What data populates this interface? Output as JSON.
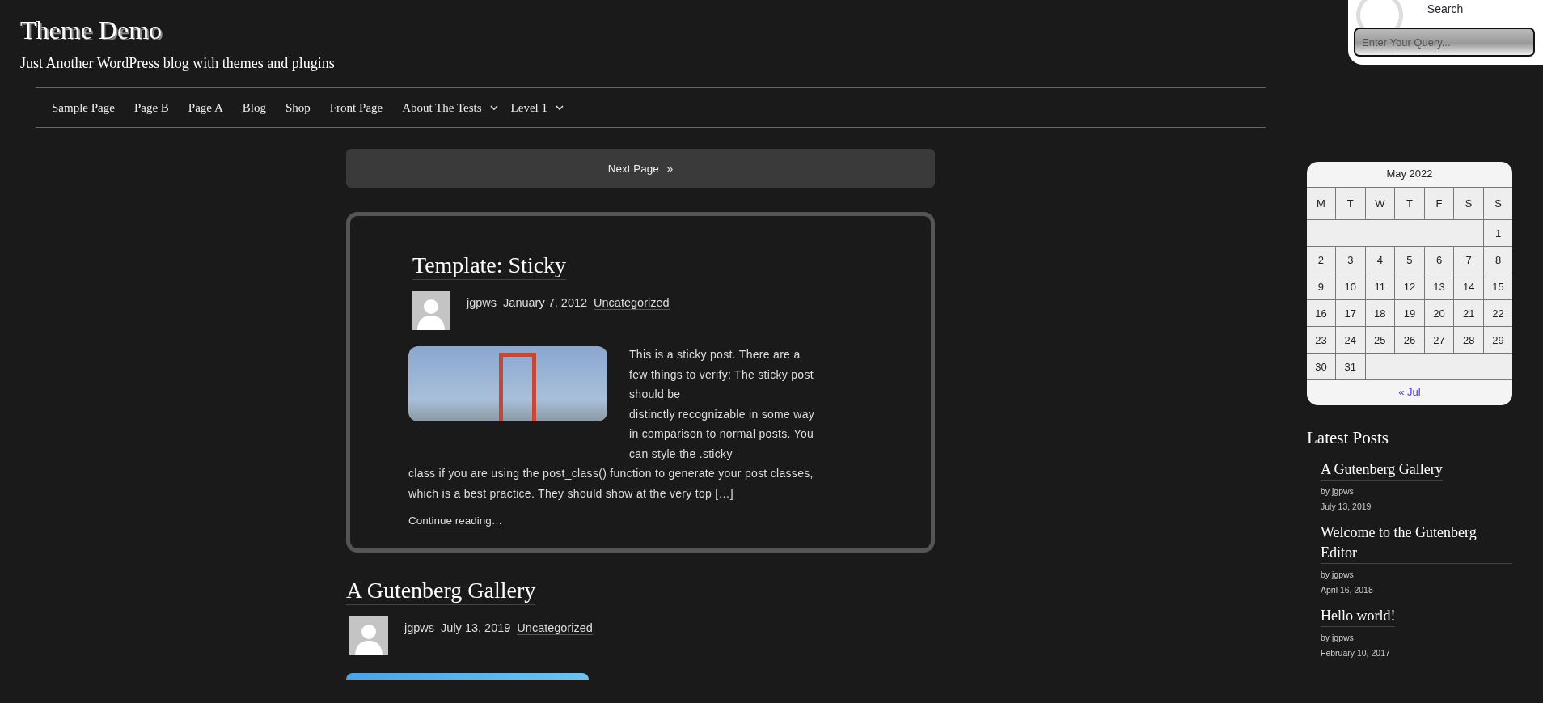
{
  "site": {
    "title": "Theme Demo",
    "tagline": "Just Another WordPress blog with themes and plugins"
  },
  "nav": {
    "items": [
      {
        "label": "Sample Page",
        "has_submenu": false
      },
      {
        "label": "Page B",
        "has_submenu": false
      },
      {
        "label": "Page A",
        "has_submenu": false
      },
      {
        "label": "Blog",
        "has_submenu": false
      },
      {
        "label": "Shop",
        "has_submenu": false
      },
      {
        "label": "Front Page",
        "has_submenu": false
      },
      {
        "label": "About The Tests",
        "has_submenu": true
      },
      {
        "label": "Level 1",
        "has_submenu": true
      }
    ]
  },
  "search": {
    "label": "Search",
    "placeholder": "Enter Your Query..."
  },
  "pagination": {
    "next": "Next Page",
    "next_glyph": "»"
  },
  "posts": [
    {
      "title": "Template: Sticky",
      "sticky": true,
      "author": "jgpws",
      "date": "January 7, 2012",
      "category": "Uncategorized",
      "excerpt_side_lines": [
        "This is a sticky post. There are a few things to verify: The sticky post should be",
        "distinctly recognizable in some way in comparison to normal posts. You can style the .sticky"
      ],
      "excerpt_below": "class if you are using the post_class() function to generate your post classes, which is a best practice. They should show at the very top […]",
      "more": "Continue reading…"
    },
    {
      "title": "A Gutenberg Gallery",
      "sticky": false,
      "author": "jgpws",
      "date": "July 13, 2019",
      "category": "Uncategorized"
    }
  ],
  "calendar": {
    "caption": "May 2022",
    "weekdays": [
      "M",
      "T",
      "W",
      "T",
      "F",
      "S",
      "S"
    ],
    "weeks": [
      {
        "leading_blank": true,
        "trailing_blank": false,
        "days": [
          "1"
        ]
      },
      {
        "leading_blank": false,
        "trailing_blank": false,
        "days": [
          "2",
          "3",
          "4",
          "5",
          "6",
          "7",
          "8"
        ]
      },
      {
        "leading_blank": false,
        "trailing_blank": false,
        "days": [
          "9",
          "10",
          "11",
          "12",
          "13",
          "14",
          "15"
        ]
      },
      {
        "leading_blank": false,
        "trailing_blank": false,
        "days": [
          "16",
          "17",
          "18",
          "19",
          "20",
          "21",
          "22"
        ]
      },
      {
        "leading_blank": false,
        "trailing_blank": false,
        "days": [
          "23",
          "24",
          "25",
          "26",
          "27",
          "28",
          "29"
        ]
      },
      {
        "leading_blank": false,
        "trailing_blank": true,
        "days": [
          "30",
          "31"
        ]
      }
    ],
    "prev": "« Jul"
  },
  "latest_posts": {
    "heading": "Latest Posts",
    "items": [
      {
        "title": "A Gutenberg Gallery",
        "author": "by jgpws",
        "date": "July 13, 2019"
      },
      {
        "title": "Welcome to the Gutenberg Editor",
        "author": "by jgpws",
        "date": "April 16, 2018"
      },
      {
        "title": "Hello world!",
        "author": "by jgpws",
        "date": "February 10, 2017"
      }
    ]
  }
}
